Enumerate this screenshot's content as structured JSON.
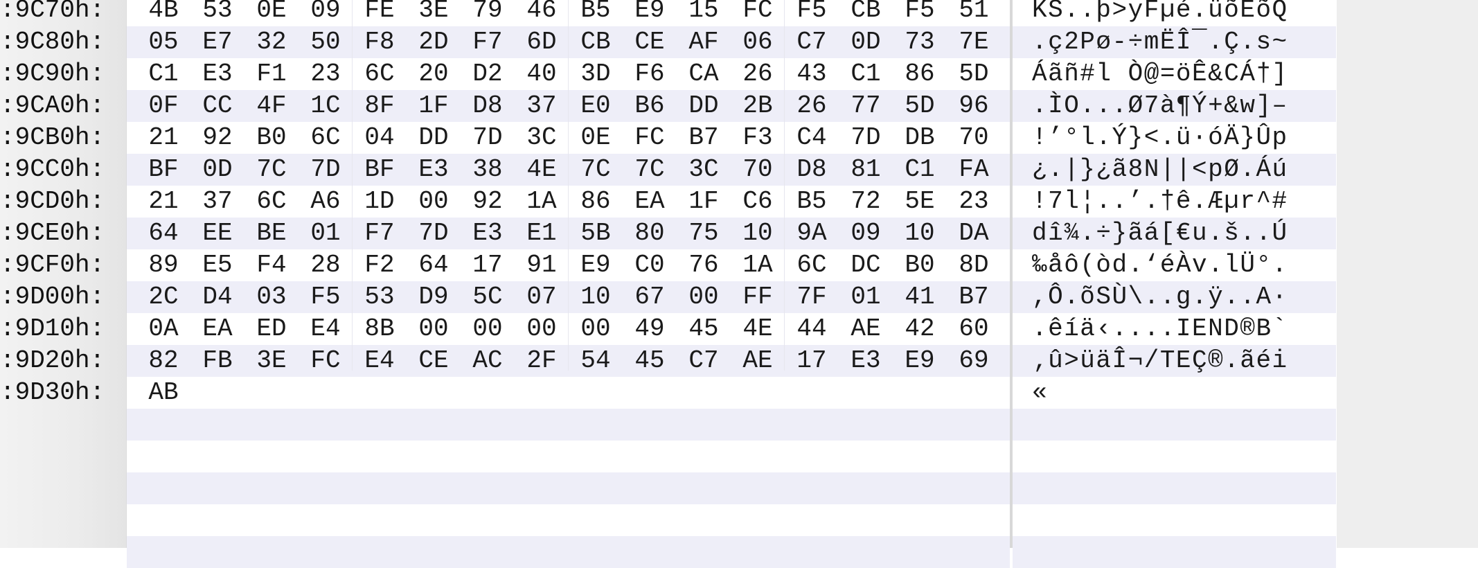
{
  "hex_view": {
    "rows": [
      {
        "address": ":9C70h:",
        "bytes": [
          "4B",
          "53",
          "0E",
          "09",
          "FE",
          "3E",
          "79",
          "46",
          "B5",
          "E9",
          "15",
          "FC",
          "F5",
          "CB",
          "F5",
          "51"
        ],
        "ascii": "KS..þ>yFµé.üõËõQ"
      },
      {
        "address": ":9C80h:",
        "bytes": [
          "05",
          "E7",
          "32",
          "50",
          "F8",
          "2D",
          "F7",
          "6D",
          "CB",
          "CE",
          "AF",
          "06",
          "C7",
          "0D",
          "73",
          "7E"
        ],
        "ascii": ".ç2Pø-÷mËÎ¯.Ç.s~"
      },
      {
        "address": ":9C90h:",
        "bytes": [
          "C1",
          "E3",
          "F1",
          "23",
          "6C",
          "20",
          "D2",
          "40",
          "3D",
          "F6",
          "CA",
          "26",
          "43",
          "C1",
          "86",
          "5D"
        ],
        "ascii": "Áãñ#l Ò@=öÊ&CÁ†]"
      },
      {
        "address": ":9CA0h:",
        "bytes": [
          "0F",
          "CC",
          "4F",
          "1C",
          "8F",
          "1F",
          "D8",
          "37",
          "E0",
          "B6",
          "DD",
          "2B",
          "26",
          "77",
          "5D",
          "96"
        ],
        "ascii": ".ÌO...Ø7à¶Ý+&w]–"
      },
      {
        "address": ":9CB0h:",
        "bytes": [
          "21",
          "92",
          "B0",
          "6C",
          "04",
          "DD",
          "7D",
          "3C",
          "0E",
          "FC",
          "B7",
          "F3",
          "C4",
          "7D",
          "DB",
          "70"
        ],
        "ascii": "!’°l.Ý}<.ü·óÄ}Ûp"
      },
      {
        "address": ":9CC0h:",
        "bytes": [
          "BF",
          "0D",
          "7C",
          "7D",
          "BF",
          "E3",
          "38",
          "4E",
          "7C",
          "7C",
          "3C",
          "70",
          "D8",
          "81",
          "C1",
          "FA"
        ],
        "ascii": "¿.|}¿ã8N||<pØ.Áú"
      },
      {
        "address": ":9CD0h:",
        "bytes": [
          "21",
          "37",
          "6C",
          "A6",
          "1D",
          "00",
          "92",
          "1A",
          "86",
          "EA",
          "1F",
          "C6",
          "B5",
          "72",
          "5E",
          "23"
        ],
        "ascii": "!7l¦..’.†ê.Æµr^#"
      },
      {
        "address": ":9CE0h:",
        "bytes": [
          "64",
          "EE",
          "BE",
          "01",
          "F7",
          "7D",
          "E3",
          "E1",
          "5B",
          "80",
          "75",
          "10",
          "9A",
          "09",
          "10",
          "DA"
        ],
        "ascii": "dî¾.÷}ãá[€u.š..Ú"
      },
      {
        "address": ":9CF0h:",
        "bytes": [
          "89",
          "E5",
          "F4",
          "28",
          "F2",
          "64",
          "17",
          "91",
          "E9",
          "C0",
          "76",
          "1A",
          "6C",
          "DC",
          "B0",
          "8D"
        ],
        "ascii": "‰åô(òd.‘éÀv.lÜ°."
      },
      {
        "address": ":9D00h:",
        "bytes": [
          "2C",
          "D4",
          "03",
          "F5",
          "53",
          "D9",
          "5C",
          "07",
          "10",
          "67",
          "00",
          "FF",
          "7F",
          "01",
          "41",
          "B7"
        ],
        "ascii": ",Ô.õSÙ\\..g.ÿ..A·"
      },
      {
        "address": ":9D10h:",
        "bytes": [
          "0A",
          "EA",
          "ED",
          "E4",
          "8B",
          "00",
          "00",
          "00",
          "00",
          "49",
          "45",
          "4E",
          "44",
          "AE",
          "42",
          "60"
        ],
        "ascii": ".êíä‹....IEND®B`"
      },
      {
        "address": ":9D20h:",
        "bytes": [
          "82",
          "FB",
          "3E",
          "FC",
          "E4",
          "CE",
          "AC",
          "2F",
          "54",
          "45",
          "C7",
          "AE",
          "17",
          "E3",
          "E9",
          "69"
        ],
        "ascii": "‚û>üäÎ¬/TEÇ®.ãéi"
      },
      {
        "address": ":9D30h:",
        "bytes": [
          "AB",
          "",
          "",
          "",
          "",
          "",
          "",
          "",
          "",
          "",
          "",
          "",
          "",
          "",
          "",
          ""
        ],
        "ascii": "«"
      }
    ]
  },
  "colors": {
    "stripe": "#eeeef8",
    "gutter": "#ececec",
    "text": "#1a1a1a"
  }
}
